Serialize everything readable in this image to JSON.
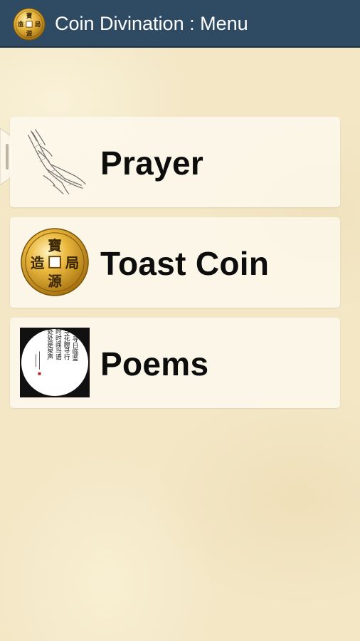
{
  "appbar": {
    "title": "Coin Divination : Menu",
    "icon": "coin-icon",
    "color": "#2f4a63"
  },
  "coin_characters": [
    "寶",
    "局",
    "源",
    "造"
  ],
  "menu": {
    "items": [
      {
        "label": "Prayer",
        "icon": "praying-hands-icon"
      },
      {
        "label": "Toast Coin",
        "icon": "coin-icon"
      },
      {
        "label": "Poems",
        "icon": "calligraphy-poem-icon"
      }
    ]
  },
  "poem": {
    "columns": [
      "寻日临鉴",
      "寻花腕寻行",
      "时时闻鸟语",
      "处处是泉声"
    ]
  },
  "colors": {
    "background": "#f3e7c6",
    "card": "#fdf9ee",
    "text": "#0d0d0d"
  }
}
